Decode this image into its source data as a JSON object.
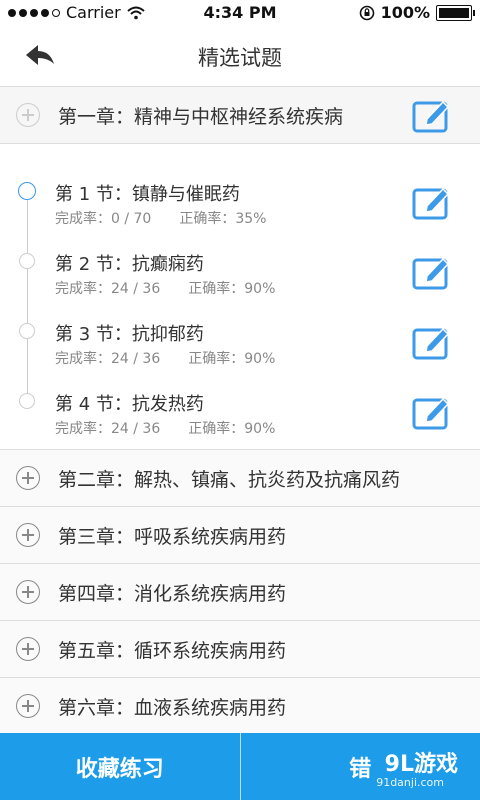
{
  "status_bar": {
    "carrier": "Carrier",
    "time": "4:34 PM",
    "battery": "100%"
  },
  "nav": {
    "title": "精选试题"
  },
  "chapter_open": {
    "label": "第一章：精神与中枢神经系统疾病"
  },
  "sections": [
    {
      "name": "第 1 节：镇静与催眠药",
      "completion": "完成率：0 / 70",
      "accuracy": "正确率：35%",
      "active": true
    },
    {
      "name": "第 2 节：抗癫痫药",
      "completion": "完成率：24 / 36",
      "accuracy": "正确率：90%",
      "active": false
    },
    {
      "name": "第 3 节：抗抑郁药",
      "completion": "完成率：24 / 36",
      "accuracy": "正确率：90%",
      "active": false
    },
    {
      "name": "第 4 节：抗发热药",
      "completion": "完成率：24 / 36",
      "accuracy": "正确率：90%",
      "active": false
    }
  ],
  "chapters": [
    {
      "label": "第二章：解热、镇痛、抗炎药及抗痛风药"
    },
    {
      "label": "第三章：呼吸系统疾病用药"
    },
    {
      "label": "第四章：消化系统疾病用药"
    },
    {
      "label": "第五章：循环系统疾病用药"
    },
    {
      "label": "第六章：血液系统疾病用药"
    }
  ],
  "bottom": {
    "favorites_label": "收藏练习",
    "errors_label": "错"
  },
  "watermark": {
    "brand": "9L游戏",
    "site": "91danji.com"
  },
  "colors": {
    "accent": "#1d9ce9",
    "icon_blue": "#3d9ae8"
  }
}
